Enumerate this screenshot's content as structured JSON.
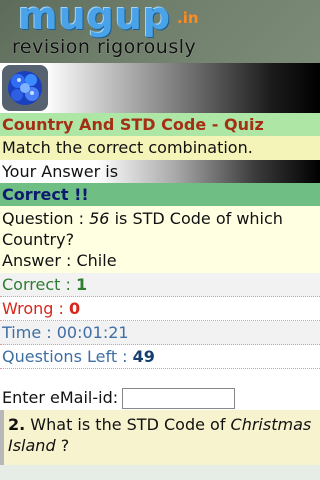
{
  "header": {
    "logo_main": "mugup",
    "logo_tld": ".in",
    "tagline": "revision rigorously"
  },
  "quiz": {
    "title": "Country And STD Code - Quiz",
    "instruction": "Match the correct combination.",
    "your_answer_label": "Your Answer is",
    "result": "Correct !!",
    "question_prefix": "Question : ",
    "question_number": "56",
    "question_suffix": " is STD Code of which Country?",
    "answer_line": "Answer : Chile"
  },
  "stats": {
    "correct_label": "Correct : ",
    "correct_value": "1",
    "wrong_label": "Wrong : ",
    "wrong_value": "0",
    "time_label": "Time : ",
    "time_value": "00:01:21",
    "left_label": "Questions Left : ",
    "left_value": "49"
  },
  "email": {
    "label": "Enter eMail-id:",
    "value": ""
  },
  "next_question": {
    "number": "2.",
    "text_before": " What is the STD Code of ",
    "subject": "Christmas Island",
    "text_after": " ?"
  },
  "colors": {
    "title_bar": "#aee6a6",
    "title_text": "#a32f14",
    "result_bar": "#6fbf85",
    "correct": "#2e7d32",
    "wrong": "#d8261b",
    "info": "#3e6ea3"
  },
  "icons": {
    "app_icon": "globe-cluster-icon"
  }
}
